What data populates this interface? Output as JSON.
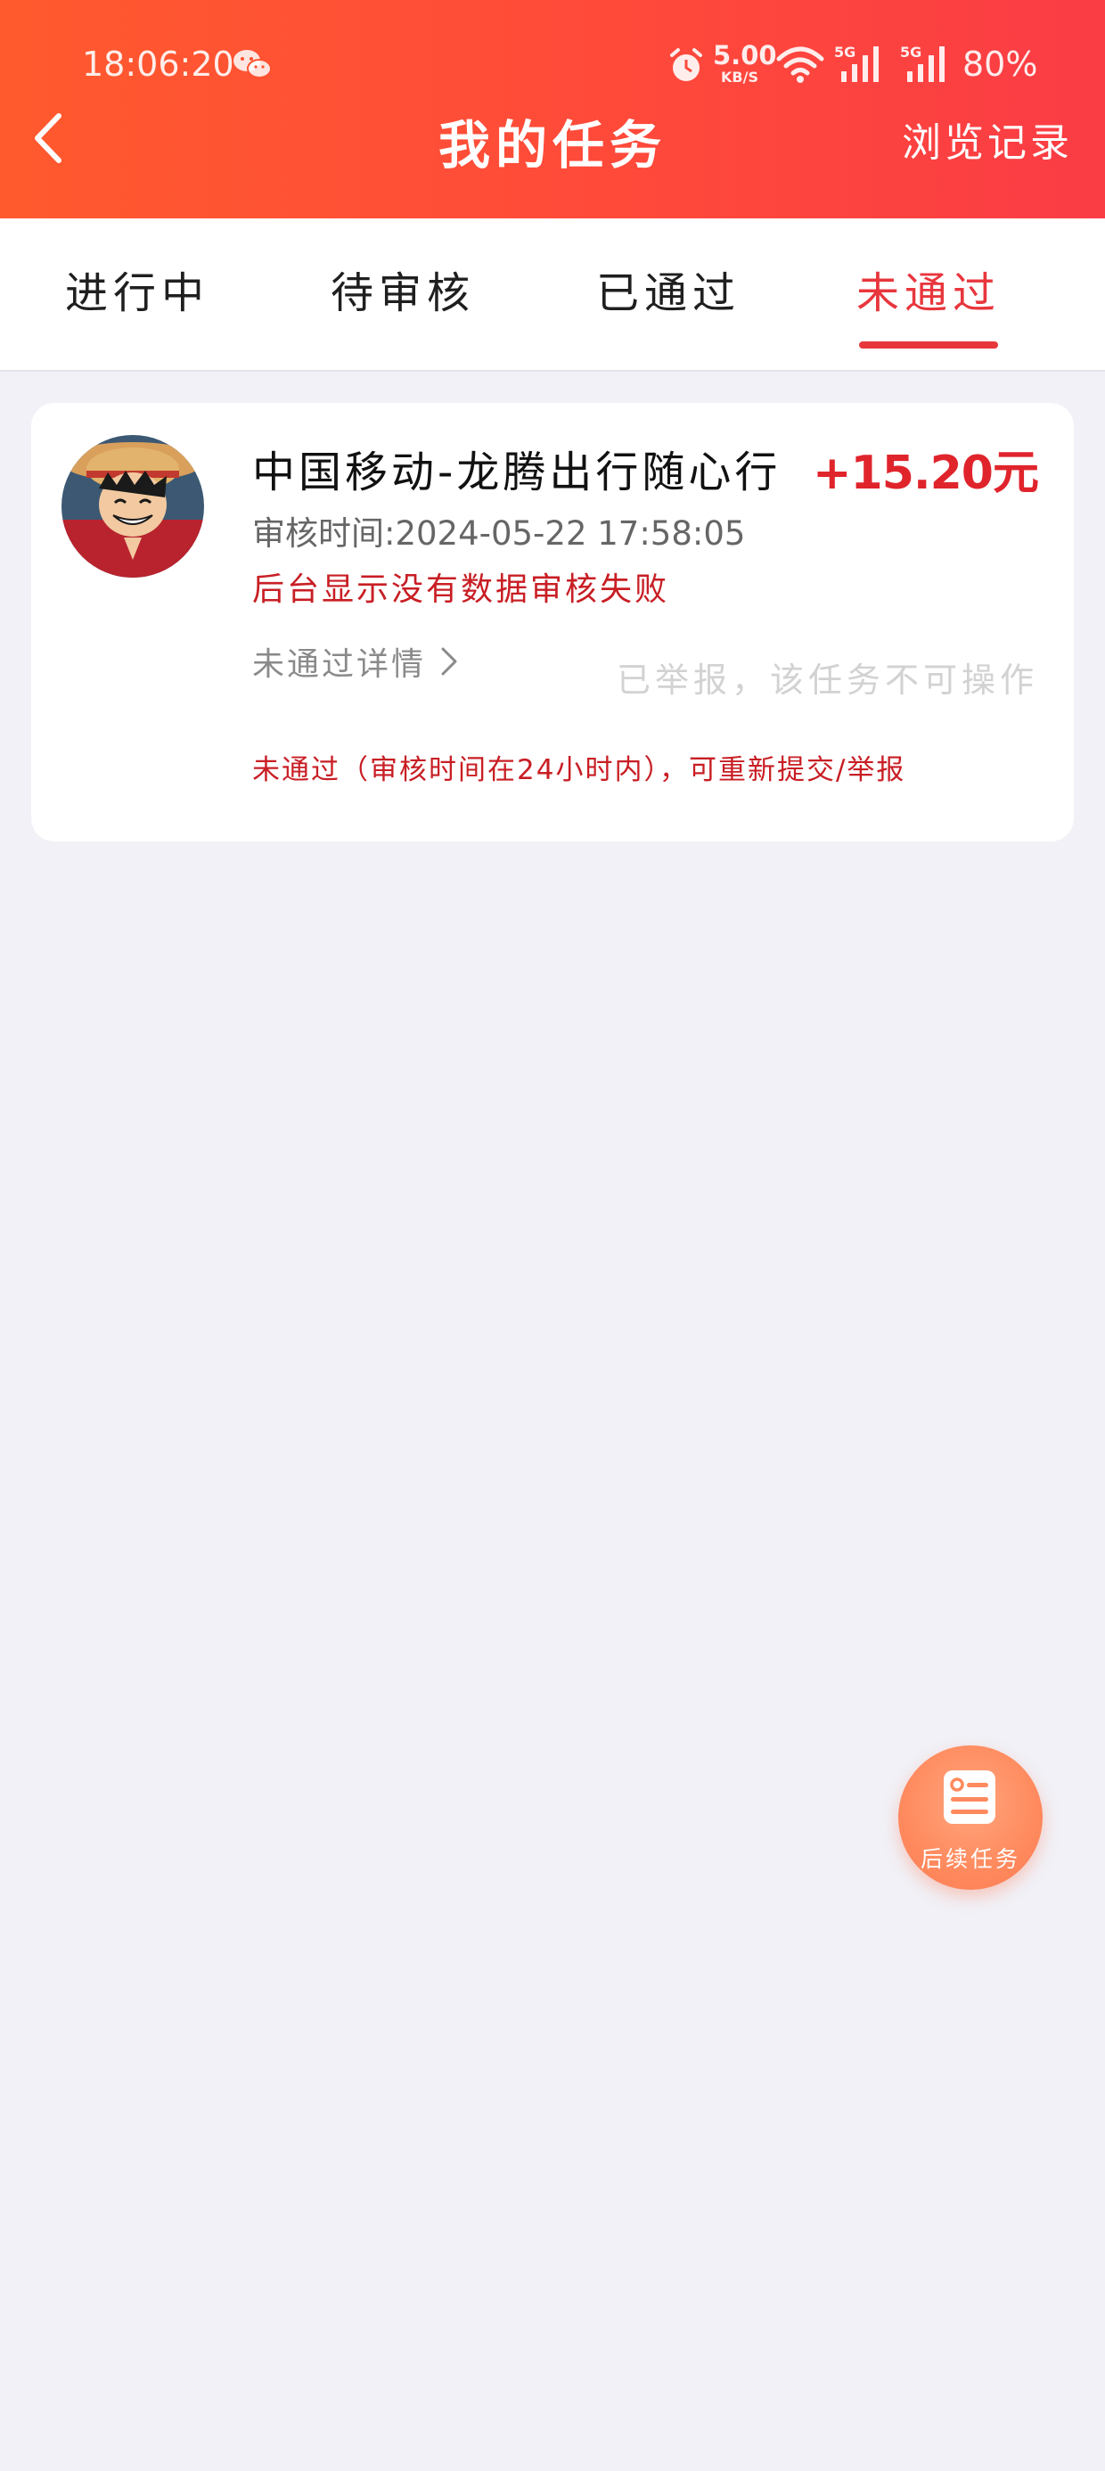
{
  "status_bar": {
    "time": "18:06:20",
    "net_speed": "5.00",
    "net_speed_unit": "KB/S",
    "signal_1_label": "5G",
    "signal_2_label": "5G",
    "battery": "80%"
  },
  "header": {
    "title": "我的任务",
    "history_label": "浏览记录"
  },
  "tabs": [
    {
      "label": "进行中",
      "active": false
    },
    {
      "label": "待审核",
      "active": false
    },
    {
      "label": "已通过",
      "active": false
    },
    {
      "label": "未通过",
      "active": true
    }
  ],
  "task": {
    "name": "中国移动-龙腾出行随心行",
    "reward": "+15.20元",
    "review_time": "审核时间:2024-05-22  17:58:05",
    "fail_reason": "后台显示没有数据审核失败",
    "detail_label": "未通过详情",
    "reported_note": "已举报，该任务不可操作",
    "resubmit_note": "未通过（审核时间在24小时内），可重新提交/举报"
  },
  "fab": {
    "label": "后续任务"
  },
  "colors": {
    "header_start": "#ff5a2e",
    "header_end": "#fa3c45",
    "accent": "#e8363d",
    "reward": "#e0242c",
    "background": "#f1f1f7"
  }
}
